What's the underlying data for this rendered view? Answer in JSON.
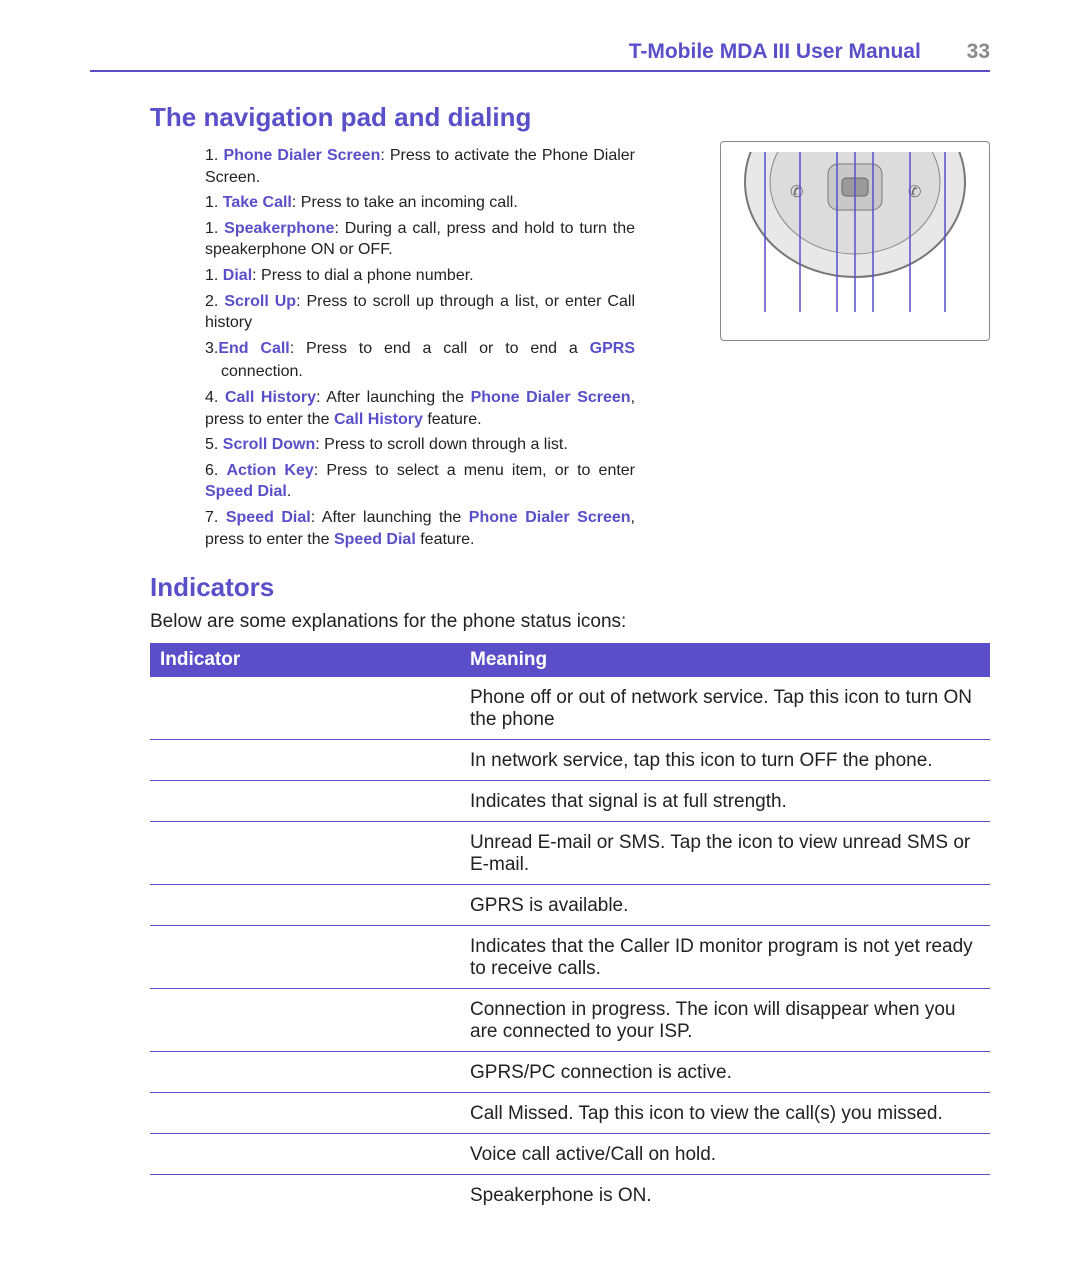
{
  "header": {
    "title": "T-Mobile MDA III User Manual",
    "page_number": "33"
  },
  "section1": {
    "title": "The navigation pad and dialing",
    "items": [
      {
        "num": "1.",
        "label": "Phone Dialer Screen",
        "text": ": Press to activate the Phone Dialer Screen."
      },
      {
        "num": "1.",
        "label": "Take Call",
        "text": ": Press to take an incoming call."
      },
      {
        "num": "1.",
        "label": "Speakerphone",
        "text": ": During a call, press and hold to turn the speakerphone ON or OFF."
      },
      {
        "num": "1.",
        "label": "Dial",
        "text": ": Press to dial a phone number."
      },
      {
        "num": "2.",
        "label": "Scroll Up",
        "text": ": Press to scroll up through a list, or enter Call history"
      },
      {
        "num": "3.",
        "label": "End Call",
        "text": ": Press to end a call or to end a ",
        "trail_hl": "GPRS",
        "trail_text": " connection."
      },
      {
        "num": "4.",
        "label": "Call History",
        "text": ": After launching the ",
        "mid_hl": "Phone Dialer Screen",
        "mid_text": ", press to enter the ",
        "mid_hl2": "Call History",
        "mid_text2": " feature."
      },
      {
        "num": "5.",
        "label": "Scroll Down",
        "text": ": Press to scroll down through a list."
      },
      {
        "num": "6.",
        "label": "Action Key",
        "text": ": Press to select a menu item, or to enter ",
        "trail_hl": "Speed Dial",
        "trail_text": "."
      },
      {
        "num": "7.",
        "label": "Speed Dial",
        "text": ": After launching the ",
        "mid_hl": "Phone Dialer Screen",
        "mid_text": ", press to enter the ",
        "mid_hl2": "Speed Dial",
        "mid_text2": " feature."
      }
    ]
  },
  "section2": {
    "title": "Indicators",
    "intro": "Below are some explanations for the phone status icons:",
    "headers": {
      "col1": "Indicator",
      "col2": "Meaning"
    },
    "rows": [
      "Phone off or out of network service. Tap this icon to turn ON the phone",
      "In network service, tap this icon to turn OFF the phone.",
      "Indicates that signal is at full strength.",
      "Unread E-mail or SMS. Tap the icon to view unread SMS or E-mail.",
      "GPRS is available.",
      "Indicates that the Caller ID monitor program is not yet ready to receive calls.",
      "Connection in progress. The icon will disappear when you are connected to your ISP.",
      "GPRS/PC connection is active.",
      "Call Missed. Tap this icon to view the call(s) you missed.",
      "Voice call active/Call on hold.",
      "Speakerphone is ON."
    ]
  }
}
